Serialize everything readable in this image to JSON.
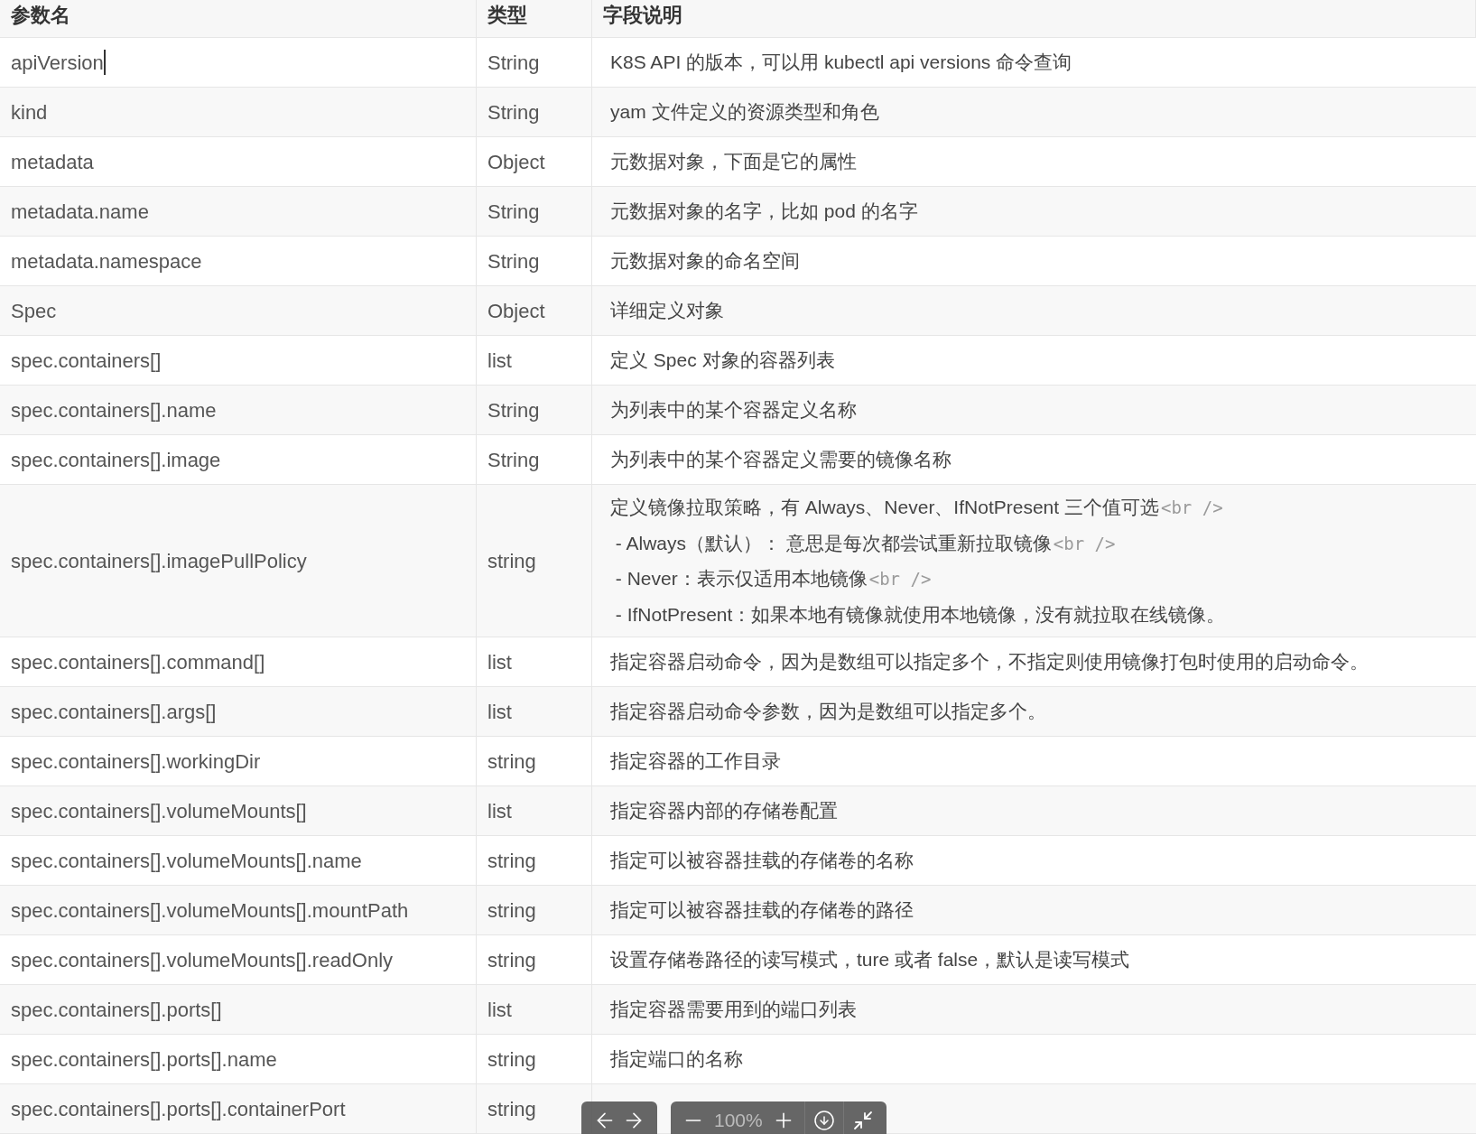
{
  "table": {
    "columns": [
      "参数名",
      "类型",
      "字段说明"
    ],
    "rows": [
      {
        "name": "apiVersion",
        "editing": true,
        "type": "String",
        "description": [
          "K8S API 的版本，可以用 kubectl api versions 命令查询"
        ]
      },
      {
        "name": "kind",
        "editing": false,
        "type": "String",
        "description": [
          "yam 文件定义的资源类型和角色"
        ]
      },
      {
        "name": "metadata",
        "editing": false,
        "type": "Object",
        "description": [
          "元数据对象，下面是它的属性"
        ]
      },
      {
        "name": "metadata.name",
        "editing": false,
        "type": "String",
        "description": [
          "元数据对象的名字，比如 pod 的名字"
        ]
      },
      {
        "name": "metadata.namespace",
        "editing": false,
        "type": "String",
        "description": [
          "元数据对象的命名空间"
        ]
      },
      {
        "name": "Spec",
        "editing": false,
        "type": "Object",
        "description": [
          "详细定义对象"
        ]
      },
      {
        "name": "spec.containers[]",
        "editing": false,
        "type": "list",
        "description": [
          "定义 Spec 对象的容器列表"
        ]
      },
      {
        "name": "spec.containers[].name",
        "editing": false,
        "type": "String",
        "description": [
          "为列表中的某个容器定义名称"
        ]
      },
      {
        "name": "spec.containers[].image",
        "editing": false,
        "type": "String",
        "description": [
          "为列表中的某个容器定义需要的镜像名称"
        ]
      },
      {
        "name": "spec.containers[].imagePullPolicy",
        "editing": false,
        "type": "string",
        "description": [
          "定义镜像拉取策略，有 Always、Never、IfNotPresent 三个值可选",
          "<br />",
          " - Always（默认）： 意思是每次都尝试重新拉取镜像",
          "<br />",
          " - Never：表示仅适用本地镜像",
          "<br />",
          " - IfNotPresent：如果本地有镜像就使用本地镜像，没有就拉取在线镜像。"
        ]
      },
      {
        "name": "spec.containers[].command[]",
        "editing": false,
        "type": "list",
        "description": [
          "指定容器启动命令，因为是数组可以指定多个，不指定则使用镜像打包时使用的启动命令。"
        ]
      },
      {
        "name": "spec.containers[].args[]",
        "editing": false,
        "type": "list",
        "description": [
          "指定容器启动命令参数，因为是数组可以指定多个。"
        ]
      },
      {
        "name": "spec.containers[].workingDir",
        "editing": false,
        "type": "string",
        "description": [
          "指定容器的工作目录"
        ]
      },
      {
        "name": "spec.containers[].volumeMounts[]",
        "editing": false,
        "type": "list",
        "description": [
          "指定容器内部的存储卷配置"
        ]
      },
      {
        "name": "spec.containers[].volumeMounts[].name",
        "editing": false,
        "type": "string",
        "description": [
          "指定可以被容器挂载的存储卷的名称"
        ]
      },
      {
        "name": "spec.containers[].volumeMounts[].mountPath",
        "editing": false,
        "type": "string",
        "description": [
          "指定可以被容器挂载的存储卷的路径"
        ]
      },
      {
        "name": "spec.containers[].volumeMounts[].readOnly",
        "editing": false,
        "type": "string",
        "description": [
          "设置存储卷路径的读写模式，ture 或者 false，默认是读写模式"
        ]
      },
      {
        "name": "spec.containers[].ports[]",
        "editing": false,
        "type": "list",
        "description": [
          "指定容器需要用到的端口列表"
        ]
      },
      {
        "name": "spec.containers[].ports[].name",
        "editing": false,
        "type": "string",
        "description": [
          "指定端口的名称"
        ]
      },
      {
        "name": "spec.containers[].ports[].containerPort",
        "editing": false,
        "type": "string"
      }
    ]
  },
  "viewer_toolbar": {
    "zoom": "100%"
  }
}
